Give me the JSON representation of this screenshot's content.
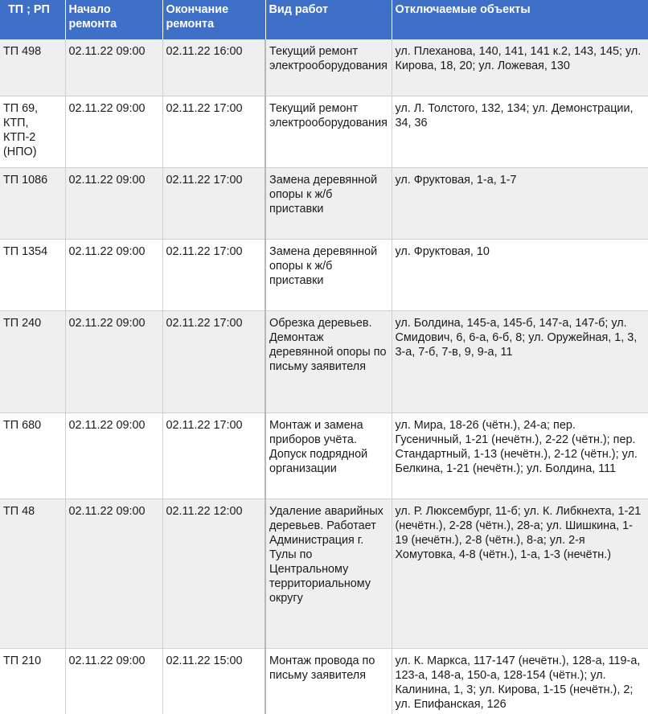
{
  "headers": [
    "ТП ; РП",
    "Начало ремонта",
    "Окончание ремонта",
    "Вид работ",
    "Отключаемые объекты"
  ],
  "rows": [
    {
      "tp": "ТП 498",
      "start": "02.11.22 09:00",
      "end": "02.11.22 16:00",
      "work": "Текущий ремонт электрооборудования",
      "objects": "ул. Плеханова, 140, 141, 141 к.2, 143, 145; ул. Кирова, 18, 20; ул. Ложевая, 130"
    },
    {
      "tp": "ТП 69, КТП, КТП-2 (НПО)",
      "start": "02.11.22 09:00",
      "end": "02.11.22 17:00",
      "work": "Текущий ремонт электрооборудования",
      "objects": "ул. Л. Толстого, 132, 134; ул. Демонстрации, 34, 36"
    },
    {
      "tp": "ТП 1086",
      "start": "02.11.22 09:00",
      "end": "02.11.22 17:00",
      "work": "Замена деревянной опоры к ж/б приставки",
      "objects": "ул. Фруктовая, 1-а, 1-7"
    },
    {
      "tp": "ТП 1354",
      "start": "02.11.22 09:00",
      "end": "02.11.22 17:00",
      "work": "Замена деревянной опоры к ж/б приставки",
      "objects": "ул. Фруктовая, 10"
    },
    {
      "tp": "ТП 240",
      "start": "02.11.22 09:00",
      "end": "02.11.22 17:00",
      "work": "Обрезка деревьев. Демонтаж деревянной опоры по письму заявителя",
      "objects": "ул. Болдина, 145-а, 145-б, 147-а, 147-б; ул. Смидович, 6, 6-а, 6-б, 8; ул. Оружейная, 1, 3, 3-а, 7-б, 7-в, 9, 9-а, 11"
    },
    {
      "tp": "ТП 680",
      "start": "02.11.22 09:00",
      "end": "02.11.22 17:00",
      "work": "Монтаж и замена приборов учёта. Допуск подрядной организации",
      "objects": "ул. Мира, 18-26 (чётн.), 24-а; пер. Гусеничный, 1-21 (нечётн.), 2-22 (чётн.); пер. Стандартный, 1-13 (нечётн.), 2-12 (чётн.); ул. Белкина, 1-21 (нечётн.); ул. Болдина, 111"
    },
    {
      "tp": "ТП 48",
      "start": "02.11.22 09:00",
      "end": "02.11.22 12:00",
      "work": "Удаление аварийных деревьев. Работает Администрация г. Тулы по Центральному территориальному округу",
      "objects": "ул. Р. Люксембург, 11-б; ул. К. Либкнехта, 1-21 (нечётн.), 2-28 (чётн.), 28-а; ул. Шишкина, 1-19 (нечётн.), 2-8 (чётн.), 8-а; ул. 2-я Хомутовка, 4-8 (чётн.), 1-а, 1-3 (нечётн.)"
    },
    {
      "tp": "ТП 210",
      "start": "02.11.22 09:00",
      "end": "02.11.22 15:00",
      "work": "Монтаж провода по письму заявителя",
      "objects": "ул. К. Маркса, 117-147 (нечётн.), 128-а, 119-а, 123-а, 148-а, 150-а, 128-154 (чётн.); ул. Калинина, 1, 3; ул. Кирова, 1-15 (нечётн.), 2; ул. Епифанская, 126"
    }
  ]
}
